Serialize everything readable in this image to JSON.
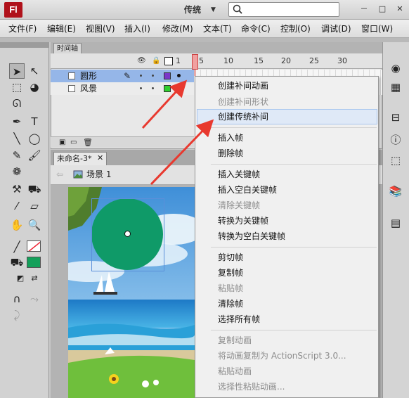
{
  "app": {
    "logo": "Fl",
    "workspace": "传统",
    "search_placeholder": ""
  },
  "window_controls": [
    "－",
    "□",
    "✕"
  ],
  "menu": [
    "文件(F)",
    "编辑(E)",
    "视图(V)",
    "插入(I)",
    "修改(M)",
    "文本(T)",
    "命令(C)",
    "控制(O)",
    "调试(D)",
    "窗口(W)"
  ],
  "timeline": {
    "tab": "时间轴",
    "frame_numbers": [
      "1",
      "5",
      "10",
      "15",
      "20",
      "25",
      "30"
    ],
    "layers": [
      {
        "name": "圆形",
        "color": "#7b36c9",
        "selected": true
      },
      {
        "name": "风景",
        "color": "#2ecf2e",
        "selected": false
      }
    ]
  },
  "document": {
    "tab": "未命名-3*",
    "scene": "场景 1"
  },
  "context_menu": {
    "items": [
      {
        "label": "创建补间动画",
        "enabled": true
      },
      {
        "label": "创建补间形状",
        "enabled": false
      },
      {
        "label": "创建传统补间",
        "enabled": true,
        "highlighted": true
      },
      {
        "label": "插入帧",
        "enabled": true
      },
      {
        "label": "删除帧",
        "enabled": true
      },
      {
        "label": "插入关键帧",
        "enabled": true
      },
      {
        "label": "插入空白关键帧",
        "enabled": true
      },
      {
        "label": "清除关键帧",
        "enabled": false
      },
      {
        "label": "转换为关键帧",
        "enabled": true
      },
      {
        "label": "转换为空白关键帧",
        "enabled": true
      },
      {
        "label": "剪切帧",
        "enabled": true
      },
      {
        "label": "复制帧",
        "enabled": true
      },
      {
        "label": "粘贴帧",
        "enabled": false
      },
      {
        "label": "清除帧",
        "enabled": true
      },
      {
        "label": "选择所有帧",
        "enabled": true
      },
      {
        "label": "复制动画",
        "enabled": false
      },
      {
        "label": "将动画复制为 ActionScript 3.0...",
        "enabled": false
      },
      {
        "label": "粘贴动画",
        "enabled": false
      },
      {
        "label": "选择性粘贴动画...",
        "enabled": false
      }
    ]
  },
  "colors": {
    "fill": "#13a05a",
    "stroke": "#ffffff",
    "accent_arrow": "#e8392f"
  }
}
